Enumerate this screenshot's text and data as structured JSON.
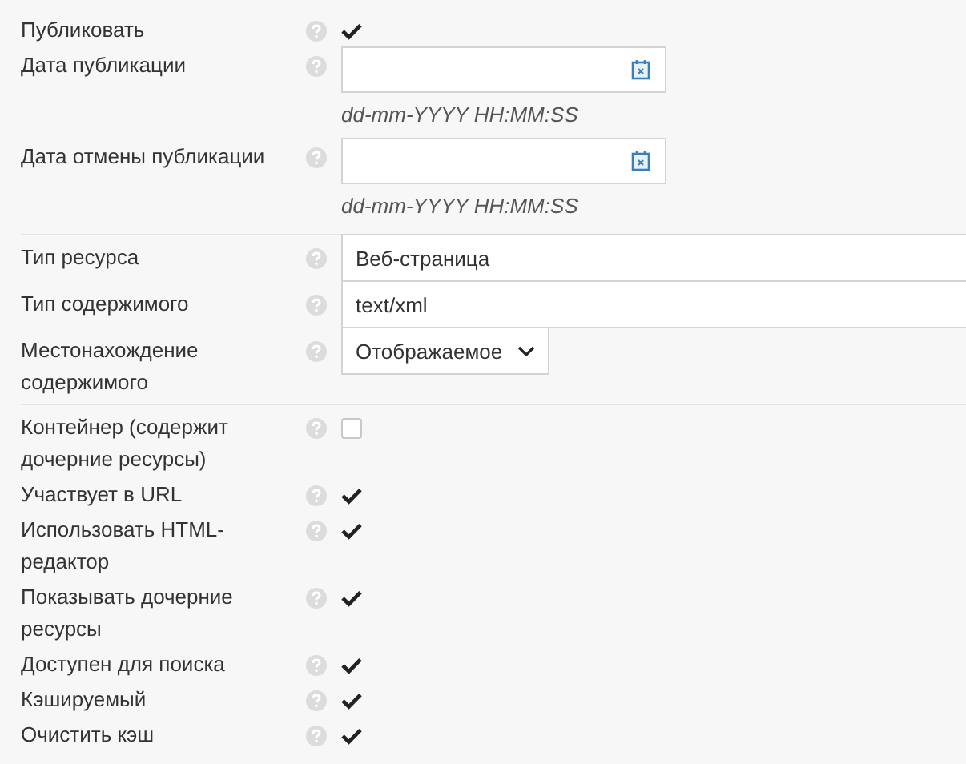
{
  "groups": [
    {
      "fields": [
        {
          "kind": "checkbox",
          "label": "Публиковать",
          "checked": true
        },
        {
          "kind": "date",
          "label": "Дата публикации",
          "hint": "dd-mm-YYYY HH:MM:SS"
        },
        {
          "kind": "date",
          "label": "Дата отмены публикации",
          "hint": "dd-mm-YYYY HH:MM:SS"
        }
      ]
    },
    {
      "fields": [
        {
          "kind": "text",
          "label": "Тип ресурса",
          "value": "Веб-страница"
        },
        {
          "kind": "text",
          "label": "Тип содержимого",
          "value": "text/xml"
        },
        {
          "kind": "select",
          "label": "Местонахождение содержимого",
          "value": "Отображаемое"
        }
      ]
    },
    {
      "fields": [
        {
          "kind": "checkbox",
          "label": "Контейнер (содержит дочерние ресурсы)",
          "checked": false
        },
        {
          "kind": "checkbox",
          "label": "Участвует в URL",
          "checked": true
        },
        {
          "kind": "checkbox",
          "label": "Использовать HTML-редактор",
          "checked": true
        },
        {
          "kind": "checkbox",
          "label": "Показывать дочерние ресурсы",
          "checked": true
        },
        {
          "kind": "checkbox",
          "label": "Доступен для поиска",
          "checked": true
        },
        {
          "kind": "checkbox",
          "label": "Кэшируемый",
          "checked": true
        },
        {
          "kind": "checkbox",
          "label": "Очистить кэш",
          "checked": true
        }
      ]
    }
  ]
}
